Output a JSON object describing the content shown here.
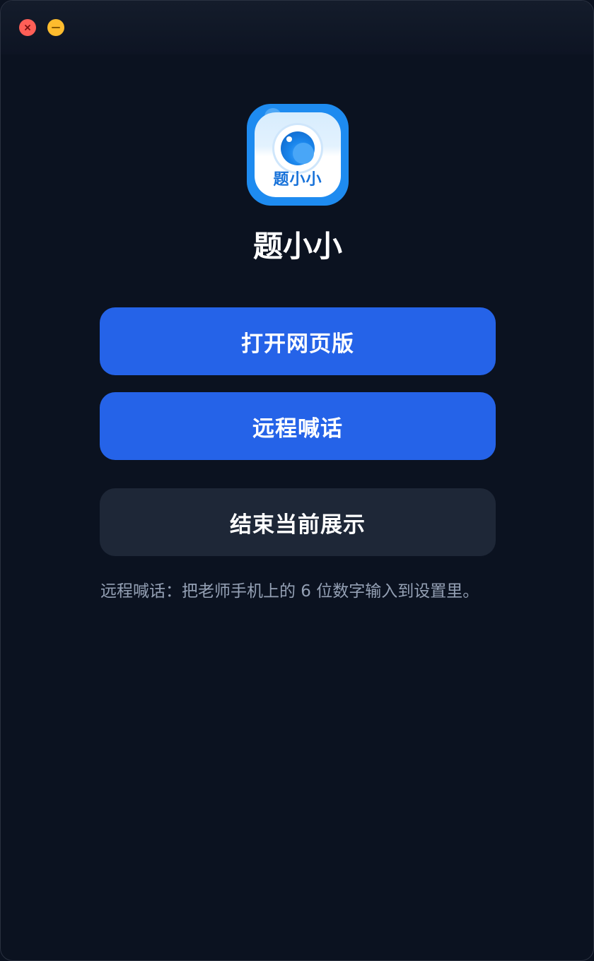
{
  "window": {
    "controls": {
      "close_icon": "close-x-icon",
      "close_color": "#ff5f57",
      "minimize_icon": "minus-icon",
      "minimize_color": "#febc2e"
    }
  },
  "app": {
    "icon_text": "题小小",
    "title": "题小小"
  },
  "actions": {
    "open_web_label": "打开网页版",
    "remote_shout_label": "远程喊话",
    "end_display_label": "结束当前展示"
  },
  "hint_text": "远程喊话：把老师手机上的 6 位数字输入到设置里。",
  "colors": {
    "background": "#0b1220",
    "primary": "#2563e8",
    "secondary": "#1e2737",
    "hint": "#94a0b4"
  }
}
